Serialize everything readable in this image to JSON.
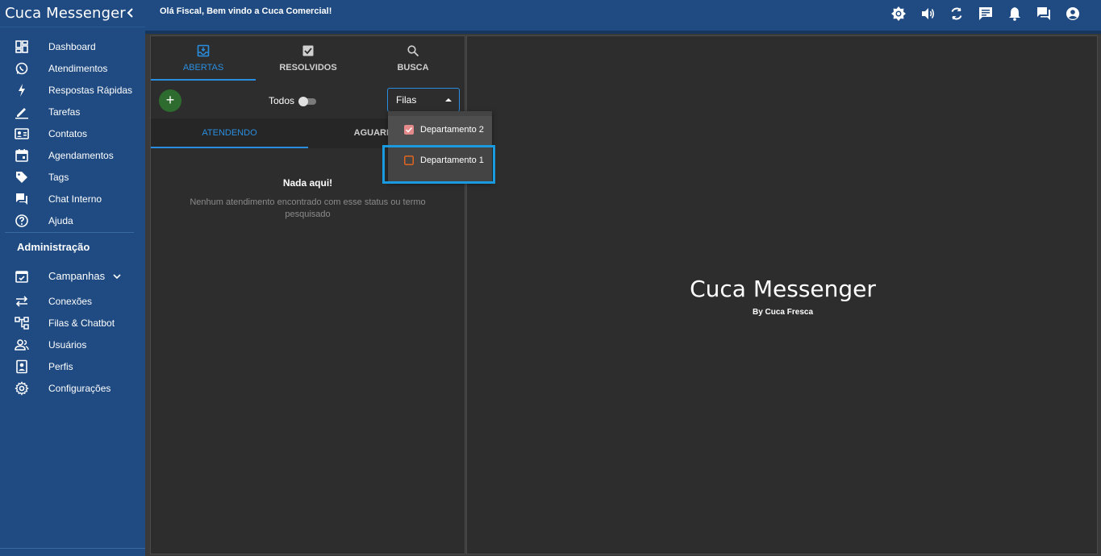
{
  "sidebar": {
    "title": "Cuca Messenger",
    "items": [
      {
        "label": "Dashboard"
      },
      {
        "label": "Atendimentos"
      },
      {
        "label": "Respostas Rápidas"
      },
      {
        "label": "Tarefas"
      },
      {
        "label": "Contatos"
      },
      {
        "label": "Agendamentos"
      },
      {
        "label": "Tags"
      },
      {
        "label": "Chat Interno"
      },
      {
        "label": "Ajuda"
      }
    ],
    "admin_title": "Administração",
    "admin_items": [
      {
        "label": "Campanhas"
      },
      {
        "label": "Conexões"
      },
      {
        "label": "Filas & Chatbot"
      },
      {
        "label": "Usuários"
      },
      {
        "label": "Perfis"
      },
      {
        "label": "Configurações"
      }
    ]
  },
  "topbar": {
    "greeting": "Olá Fiscal, Bem vindo a Cuca Comercial!",
    "icons": [
      "brightness-icon",
      "volume-icon",
      "refresh-icon",
      "chat-icon",
      "bell-icon",
      "forum-icon",
      "account-icon"
    ]
  },
  "tickets": {
    "tabs": [
      {
        "label": "ABERTAS"
      },
      {
        "label": "RESOLVIDOS"
      },
      {
        "label": "BUSCA"
      }
    ],
    "todos_label": "Todos",
    "todos_enabled": false,
    "queue_select": {
      "value": "Filas"
    },
    "subtabs": [
      {
        "label": "ATENDENDO"
      },
      {
        "label": "AGUARDANDO"
      }
    ],
    "empty_title": "Nada aqui!",
    "empty_desc": "Nenhum atendimento encontrado com esse status ou termo pesquisado"
  },
  "queue_menu": {
    "items": [
      {
        "label": "Departamento 2",
        "checked": true
      },
      {
        "label": "Departamento 1",
        "checked": false
      }
    ],
    "colors": {
      "checked": "#e58a8a",
      "unchecked": "#e0651e"
    }
  },
  "brand": {
    "name": "Cuca Messenger",
    "byline": "By Cuca Fresca"
  },
  "colors": {
    "accent": "#2a8ee0",
    "sidebar": "#1f4b82",
    "highlight": "#1a9be0"
  }
}
